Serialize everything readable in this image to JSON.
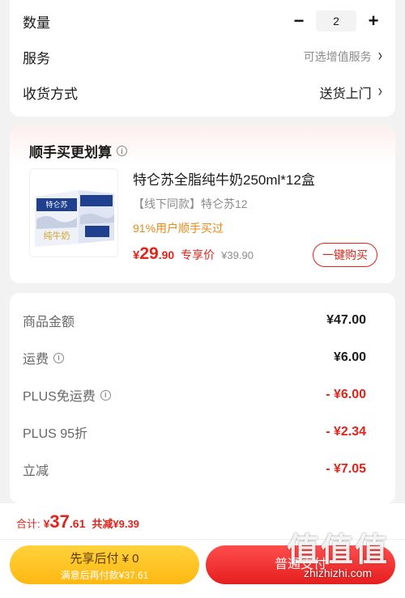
{
  "options": {
    "quantity_label": "数量",
    "quantity_value": "2",
    "minus_symbol": "−",
    "plus_symbol": "+",
    "service_label": "服务",
    "service_value": "可选增值服务",
    "delivery_label": "收货方式",
    "delivery_value": "送货上门",
    "chevron": "›"
  },
  "bundle": {
    "title": "顺手买更划算",
    "info_icon": "i",
    "product_name": "特仑苏全脂纯牛奶250ml*12盒",
    "product_sub": "【线下同款】特仑苏12",
    "product_bought": "91%用户顺手买过",
    "price_symbol": "¥",
    "price_int": "29",
    "price_dec": ".90",
    "price_tag": "专享价",
    "price_orig": "¥39.90",
    "buy_button": "一键购买",
    "image_text_brand": "特仑苏",
    "image_text_product": "纯牛奶"
  },
  "price_details": {
    "goods_label": "商品金额",
    "goods_value": "¥47.00",
    "shipping_label": "运费",
    "shipping_value": "¥6.00",
    "plus_free_label": "PLUS免运费",
    "plus_free_value": "- ¥6.00",
    "plus_discount_label": "PLUS 95折",
    "plus_discount_value": "- ¥2.34",
    "instant_label": "立减",
    "instant_value": "- ¥7.05"
  },
  "footer": {
    "total_label": "合计:",
    "total_symbol": "¥",
    "total_int": "37",
    "total_dec": ".61",
    "total_saved": "共减¥9.39",
    "pay_later_line1": "先享后付 ¥ 0",
    "pay_later_line2": "满意后再付款¥37.61",
    "normal_pay": "普通支付"
  },
  "watermark": {
    "logo": "值值值",
    "site": "zhizhizhi.com"
  },
  "colors": {
    "accent_red": "#e2231a",
    "orange": "#e88a17",
    "yellow": "#ffc21f"
  }
}
